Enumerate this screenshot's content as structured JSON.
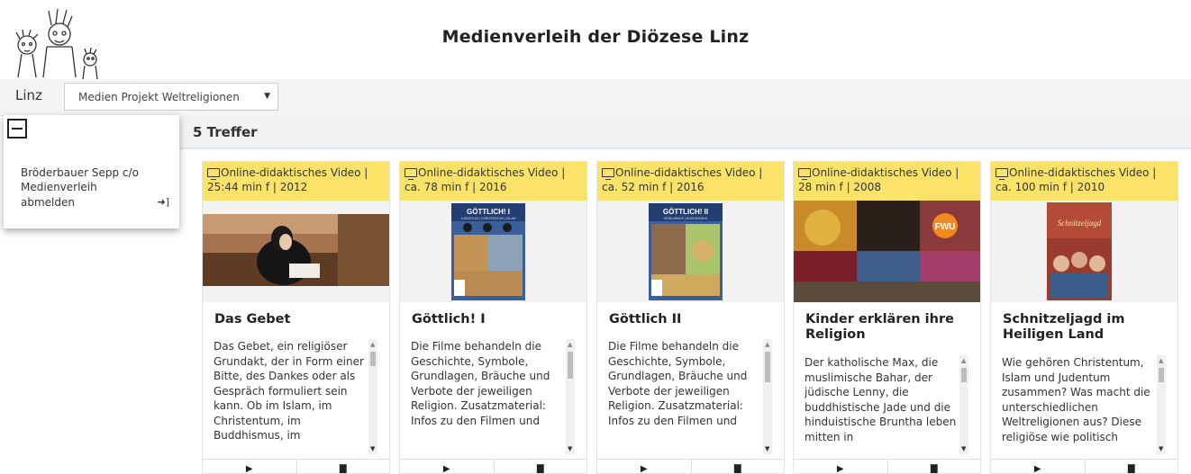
{
  "site": {
    "title": "Medienverleih der Diözese Linz"
  },
  "topbar": {
    "place": "Linz",
    "select_value": "Medien Projekt Weltreligionen"
  },
  "sidepanel": {
    "user": "Bröderbauer Sepp c/o Medienverleih",
    "logout": "abmelden"
  },
  "results": {
    "count_label": "5 Treffer"
  },
  "cards": [
    {
      "meta": "Online-didaktisches Video | 25:44 min f | 2012",
      "title": "Das Gebet",
      "desc": "Das Gebet, ein religiöser Grundakt, der in Form einer Bitte, des Dankes oder als Gespräch formuliert sein kann. Ob im Islam, im Christentum, im Buddhismus, im"
    },
    {
      "meta": "Online-didaktisches Video | ca. 78 min f | 2016",
      "title": "Göttlich! I",
      "desc": "Die Filme behandeln die Geschichte, Symbole, Grundlagen, Bräuche und Verbote der jeweiligen Religion. Zusatzmaterial: Infos zu den Filmen und",
      "cover": "GÖTTLICH! I",
      "cover_sub": "JUDENTUM | CHRISTENTUM | ISLAM"
    },
    {
      "meta": "Online-didaktisches Video | ca. 52 min f | 2016",
      "title": "Göttlich II",
      "desc": "Die Filme behandeln die Geschichte, Symbole, Grundlagen, Bräuche und Verbote der jeweiligen Religion. Zusatzmaterial: Infos zu den Filmen und",
      "cover": "GÖTTLICH! II",
      "cover_sub": "HINDUISMUS | BUDDHISMUS"
    },
    {
      "meta": "Online-didaktisches Video | 28 min f | 2008",
      "title": "Kinder erklären ihre Religion",
      "desc": "Der katholische Max, die muslimische Bahar, der jüdische Lenny, die buddhistische Jade und die hinduistische Bruntha leben mitten in",
      "badge": "FWU"
    },
    {
      "meta": "Online-didaktisches Video | ca. 100 min f | 2010",
      "title": "Schnitzeljagd im Heiligen Land",
      "desc": "Wie gehören Christentum, Islam und Judentum zusammen? Was macht die unterschiedlichen Weltreligionen aus? Diese religiöse wie politisch",
      "cover": "Schnitzeljagd"
    }
  ],
  "icons": {
    "monitor": "monitor-icon",
    "play": "play-icon",
    "document": "document-icon",
    "logout": "sign-in-icon",
    "minus": "minus-square-icon"
  },
  "colors": {
    "meta_bg": "#fbe36a",
    "topbar_bg": "#f4f4f4"
  }
}
